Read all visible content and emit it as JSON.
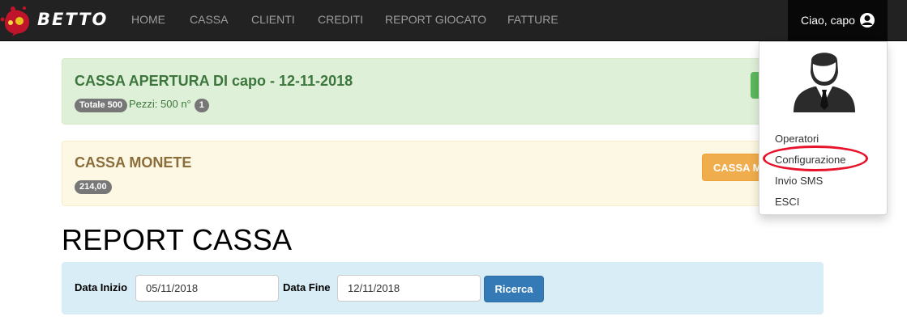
{
  "navbar": {
    "brand": "BETTO",
    "links": [
      "HOME",
      "CASSA",
      "CLIENTI",
      "CREDITI",
      "REPORT GIOCATO",
      "FATTURE"
    ],
    "user_label": "Ciao, capo"
  },
  "user_menu": {
    "items": [
      "Operatori",
      "Configurazione",
      "Invio SMS",
      "ESCI"
    ],
    "highlighted_item": "Configurazione",
    "highlight_color": "#e8132a"
  },
  "cassa_apertura": {
    "title": "CASSA APERTURA DI capo - 12-11-2018",
    "totale_badge": "Totale 500",
    "pezzi_text": "Pezzi: 500 n°",
    "count_badge": "1"
  },
  "cassa_monete": {
    "title": "CASSA MONETE",
    "amount_badge": "214,00",
    "button_label": "CASSA M"
  },
  "report": {
    "title": "REPORT CASSA",
    "start_label": "Data Inizio",
    "start_value": "05/11/2018",
    "end_label": "Data Fine",
    "end_value": "12/11/2018",
    "search_button": "Ricerca"
  },
  "colors": {
    "navbar_bg": "#222222",
    "success_bg": "#dff0d8",
    "warning_bg": "#fcf8e3",
    "info_bg": "#d9edf7",
    "primary": "#337ab7",
    "warning_button": "#f0ad4e",
    "success_button": "#5cb85c"
  }
}
